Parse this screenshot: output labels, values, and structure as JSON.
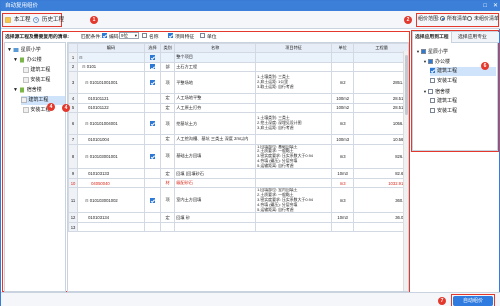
{
  "window": {
    "title": "自动复用组价"
  },
  "toolbar": {
    "this_project": "本工程",
    "history_project": "历史工程",
    "price_scope_label": "组价范围:",
    "scope_all": "所有清单",
    "scope_unpriced": "未组价清单"
  },
  "left": {
    "header": "选择源工程及需要复用的清单:",
    "tree": [
      {
        "label": "星辰小学",
        "level": 0,
        "expander": "▼"
      },
      {
        "label": "办公楼",
        "level": 1,
        "expander": "▼"
      },
      {
        "label": "建筑工程",
        "level": 2,
        "expander": ""
      },
      {
        "label": "安装工程",
        "level": 2,
        "expander": ""
      },
      {
        "label": "宿舍楼",
        "level": 1,
        "expander": "▼"
      },
      {
        "label": "建筑工程",
        "level": 2,
        "expander": ""
      },
      {
        "label": "安装工程",
        "level": 2,
        "expander": ""
      }
    ]
  },
  "filter": {
    "match_label": "匹配条件:",
    "code_label": "编码",
    "digits_value": "9位",
    "name_label": "名称",
    "feature_label": "项目特征",
    "unit_label": "单位"
  },
  "grid": {
    "columns": [
      "",
      "编码",
      "选择",
      "类别",
      "名称",
      "项目特征",
      "单位",
      "工程量"
    ],
    "rows": [
      {
        "no": "1",
        "code": "",
        "check": "on",
        "type": "",
        "name": "整个项目",
        "feature": "",
        "unit": "",
        "qty": "",
        "tall": false,
        "red": false,
        "indent": 0
      },
      {
        "no": "2",
        "code": "0101",
        "check": "on",
        "type": "部",
        "name": "土石方工程",
        "feature": "",
        "unit": "",
        "qty": "",
        "tall": false,
        "red": false,
        "indent": 1
      },
      {
        "no": "3",
        "code": "010101001001",
        "check": "on",
        "type": "项",
        "name": "平整场地",
        "feature": "1.土壤类别: 三类土\n2.弃土运距: 1公里\n3.取土运距: 自行考虑",
        "unit": "m2",
        "qty": "2851.33",
        "tall": true,
        "red": false,
        "indent": 2
      },
      {
        "no": "4",
        "code": "010101121",
        "check": "",
        "type": "定",
        "name": "人工场地平整",
        "feature": "",
        "unit": "100m2",
        "qty": "28.5133",
        "tall": false,
        "red": false,
        "indent": 3
      },
      {
        "no": "5",
        "code": "010101122",
        "check": "",
        "type": "定",
        "name": "人工原土打夯",
        "feature": "",
        "unit": "100m2",
        "qty": "28.5133",
        "tall": false,
        "red": false,
        "indent": 3
      },
      {
        "no": "6",
        "code": "010101004001",
        "check": "on",
        "type": "项",
        "name": "挖基坑土方",
        "feature": "1.土壤类别: 三类土\n2.挖土深度: 深埋见设计图\n3.弃土运距: 自行考虑",
        "unit": "m3",
        "qty": "1056.32",
        "tall": true,
        "red": false,
        "indent": 2
      },
      {
        "no": "7",
        "code": "010101004",
        "check": "",
        "type": "定",
        "name": "人工挖沟槽、基坑 三类土 深度 2m以内",
        "feature": "",
        "unit": "100m3",
        "qty": "10.5632",
        "tall": false,
        "red": false,
        "indent": 3
      },
      {
        "no": "8",
        "code": "010103001001",
        "check": "on",
        "type": "项",
        "name": "基础土方回填",
        "feature": "1.回填部位: 基础回填土\n2.土质要求: 一般黏土\n3.密实度要求: 压实系数大于0.94\n4.夯填 (碾压): 分层夯填\n5.运输距离: 自行考虑",
        "unit": "m3",
        "qty": "826.33",
        "tall": true,
        "red": false,
        "indent": 2
      },
      {
        "no": "9",
        "code": "010103133",
        "check": "",
        "type": "定",
        "name": "回填 (回填砂石",
        "feature": "",
        "unit": "10m3",
        "qty": "82.633",
        "tall": false,
        "red": false,
        "indent": 3
      },
      {
        "no": "10",
        "code": "04050040",
        "check": "",
        "type": "材",
        "name": "级配砂石",
        "feature": "",
        "unit": "m3",
        "qty": "1032.9135",
        "tall": false,
        "red": true,
        "indent": 4
      },
      {
        "no": "11",
        "code": "010103001002",
        "check": "on",
        "type": "项",
        "name": "室内土方回填",
        "feature": "1.回填部位: 室内回填土\n2.土质要求: 一般黏土\n3.密实度要求: 压实系数大于0.94\n4.夯填 (碾压): 分层夯填\n5.运输距离: 自行考虑",
        "unit": "m3",
        "qty": "360.69",
        "tall": true,
        "red": false,
        "indent": 2
      },
      {
        "no": "12",
        "code": "010103134",
        "check": "",
        "type": "定",
        "name": "回填 砂",
        "feature": "",
        "unit": "10m3",
        "qty": "36.069",
        "tall": false,
        "red": false,
        "indent": 3
      },
      {
        "no": "13",
        "code": "",
        "check": "",
        "type": "",
        "name": "",
        "feature": "",
        "unit": "",
        "qty": "",
        "tall": false,
        "red": false,
        "indent": 3
      }
    ]
  },
  "right": {
    "tab_apply": "选择应用到工程",
    "tab_major": "选择应用专业",
    "tree": [
      {
        "label": "星辰小学",
        "level": 0,
        "check": "partial"
      },
      {
        "label": "办公楼",
        "level": 1,
        "check": "partial"
      },
      {
        "label": "建筑工程",
        "level": 2,
        "check": "on",
        "sel": true
      },
      {
        "label": "安装工程",
        "level": 2,
        "check": ""
      },
      {
        "label": "宿舍楼",
        "level": 1,
        "check": ""
      },
      {
        "label": "建筑工程",
        "level": 2,
        "check": ""
      },
      {
        "label": "安装工程",
        "level": 2,
        "check": ""
      }
    ]
  },
  "footer": {
    "apply_button": "自动组价"
  },
  "badges": [
    "1",
    "2",
    "3",
    "4",
    "5",
    "6",
    "7"
  ],
  "colors": {
    "accent": "#2f7be0",
    "highlight": "#e5382c",
    "selection": "#cfe3fb"
  }
}
